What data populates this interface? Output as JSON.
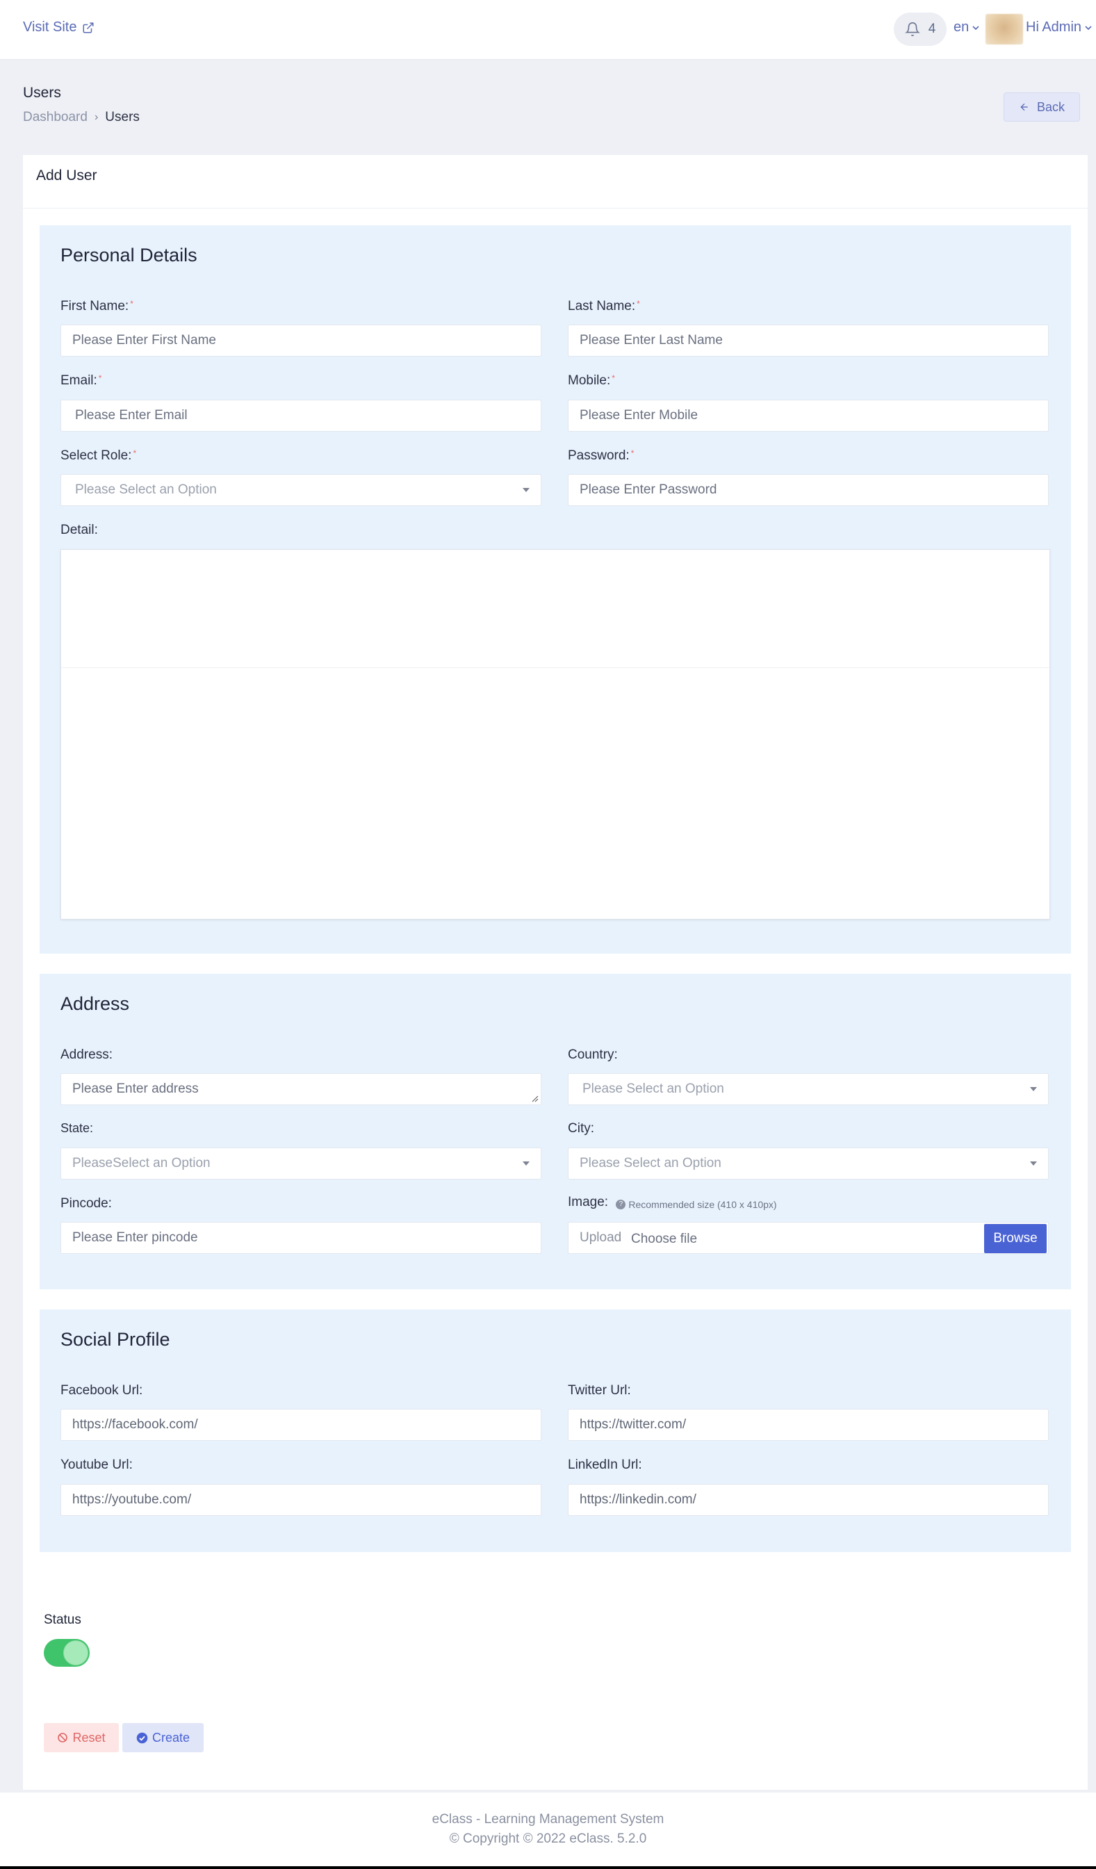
{
  "topbar": {
    "visit_site": "Visit Site",
    "notification_count": "4",
    "language": "en",
    "greeting": "Hi Admin"
  },
  "header": {
    "title": "Users",
    "breadcrumb": [
      "Dashboard",
      "Users"
    ],
    "back_label": "Back"
  },
  "card": {
    "title": "Add User"
  },
  "personal": {
    "heading": "Personal Details",
    "first_name": {
      "label": "First Name:",
      "placeholder": "Please Enter First Name"
    },
    "last_name": {
      "label": "Last Name:",
      "placeholder": "Please Enter Last Name"
    },
    "email": {
      "label": "Email:",
      "placeholder": "Please Enter Email"
    },
    "mobile": {
      "label": "Mobile:",
      "placeholder": "Please Enter Mobile"
    },
    "role": {
      "label": "Select Role:",
      "placeholder": "Please Select an Option"
    },
    "password": {
      "label": "Password:",
      "placeholder": "Please Enter Password"
    },
    "detail": {
      "label": "Detail:"
    },
    "required_mark": "*"
  },
  "address": {
    "heading": "Address",
    "address": {
      "label": "Address:",
      "placeholder": "Please Enter address"
    },
    "country": {
      "label": "Country:",
      "placeholder": "Please Select an Option"
    },
    "state": {
      "label": "State:",
      "placeholder": "PleaseSelect an Option"
    },
    "city": {
      "label": "City:",
      "placeholder": "Please Select an Option"
    },
    "pincode": {
      "label": "Pincode:",
      "placeholder": "Please Enter pincode"
    },
    "image": {
      "label": "Image:",
      "hint": "Recommended size (410 x 410px)",
      "upload": "Upload",
      "choose": "Choose file",
      "browse": "Browse"
    }
  },
  "social": {
    "heading": "Social Profile",
    "facebook": {
      "label": "Facebook Url:",
      "value": "https://facebook.com/"
    },
    "twitter": {
      "label": "Twitter Url:",
      "value": "https://twitter.com/"
    },
    "youtube": {
      "label": "Youtube Url:",
      "value": "https://youtube.com/"
    },
    "linkedin": {
      "label": "LinkedIn Url:",
      "value": "https://linkedin.com/"
    }
  },
  "status": {
    "label": "Status",
    "enabled": true
  },
  "actions": {
    "reset": "Reset",
    "create": "Create"
  },
  "footer": {
    "line1": "eClass - Learning Management System",
    "line2": "© Copyright © 2022 eClass. 5.2.0"
  },
  "colors": {
    "accent": "#4a63d4",
    "section_bg": "#e8f2fd",
    "toggle_on": "#3fc36b",
    "reset": "#e06565"
  }
}
